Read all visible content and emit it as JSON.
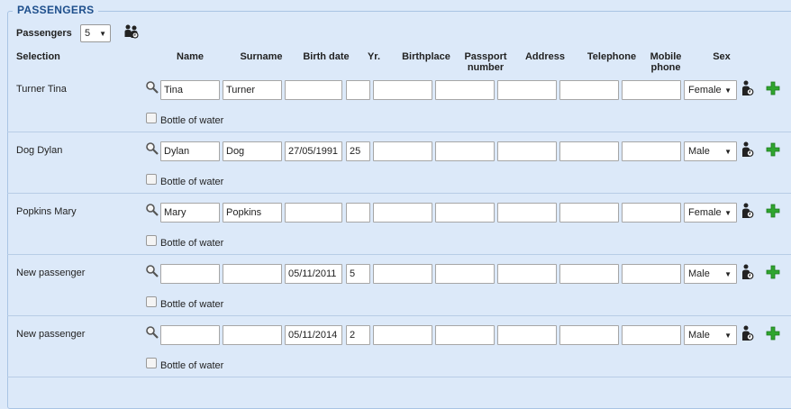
{
  "section": {
    "title": "PASSENGERS"
  },
  "passengers_count": {
    "label": "Passengers",
    "value": "5"
  },
  "columns": {
    "selection": "Selection",
    "name": "Name",
    "surname": "Surname",
    "birth_date": "Birth date",
    "yr": "Yr.",
    "birthplace": "Birthplace",
    "passport": "Passport number",
    "address": "Address",
    "telephone": "Telephone",
    "mobile": "Mobile phone",
    "sex": "Sex"
  },
  "extra_label": "Bottle of water",
  "rows": [
    {
      "label": "Turner Tina",
      "name": "Tina",
      "surname": "Turner",
      "birth_date": "",
      "yr": "",
      "birthplace": "",
      "passport": "",
      "address": "",
      "telephone": "",
      "mobile": "",
      "sex": "Female"
    },
    {
      "label": "Dog Dylan",
      "name": "Dylan",
      "surname": "Dog",
      "birth_date": "27/05/1991",
      "yr": "25",
      "birthplace": "",
      "passport": "",
      "address": "",
      "telephone": "",
      "mobile": "",
      "sex": "Male"
    },
    {
      "label": "Popkins Mary",
      "name": "Mary",
      "surname": "Popkins",
      "birth_date": "",
      "yr": "",
      "birthplace": "",
      "passport": "",
      "address": "",
      "telephone": "",
      "mobile": "",
      "sex": "Female"
    },
    {
      "label": "New passenger",
      "name": "",
      "surname": "",
      "birth_date": "05/11/2011",
      "yr": "5",
      "birthplace": "",
      "passport": "",
      "address": "",
      "telephone": "",
      "mobile": "",
      "sex": "Male"
    },
    {
      "label": "New passenger",
      "name": "",
      "surname": "",
      "birth_date": "05/11/2014",
      "yr": "2",
      "birthplace": "",
      "passport": "",
      "address": "",
      "telephone": "",
      "mobile": "",
      "sex": "Male"
    }
  ],
  "icons": {
    "group": "group-icon",
    "search": "magnifier-icon",
    "person": "person-icon",
    "add": "plus-icon"
  }
}
